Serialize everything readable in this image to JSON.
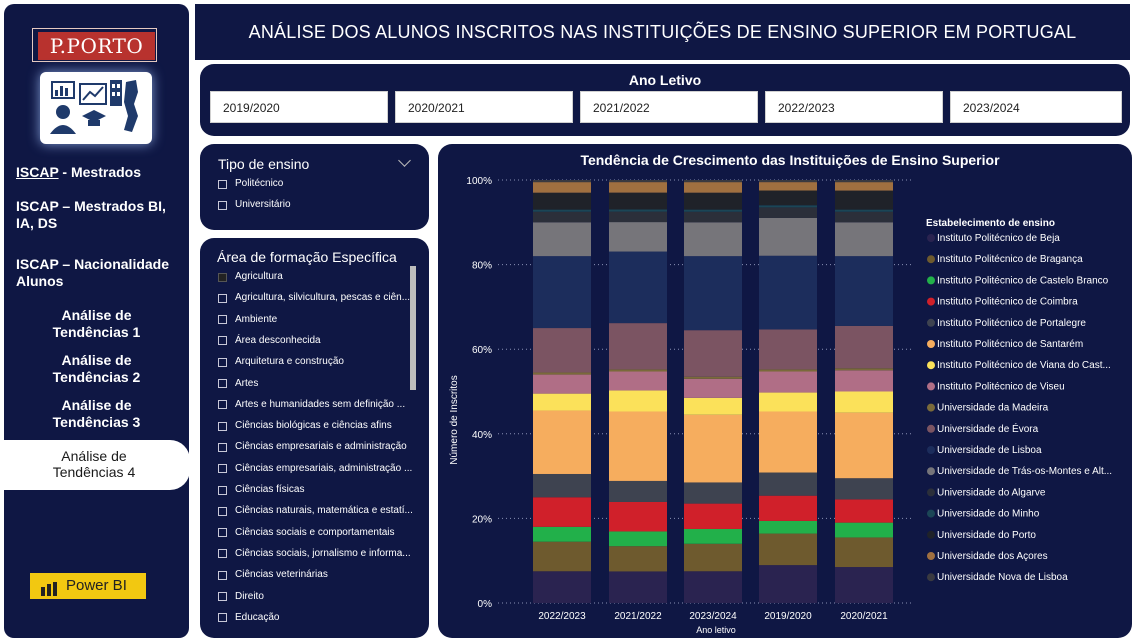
{
  "app": {
    "logo_text": "P.PORTO",
    "powerbi_label": "Power BI",
    "header_title": "ANÁLISE DOS ALUNOS INSCRITOS NAS INSTITUIÇÕES DE ENSINO SUPERIOR EM PORTUGAL"
  },
  "sidebar": {
    "items": [
      {
        "prefix": "ISCAP",
        "label": " - Mestrados"
      },
      {
        "label": "ISCAP – Mestrados BI, IA, DS"
      },
      {
        "label": "ISCAP – Nacionalidade Alunos"
      },
      {
        "label": "Análise de Tendências 1"
      },
      {
        "label": "Análise de Tendências 2"
      },
      {
        "label": "Análise de Tendências 3"
      },
      {
        "label": "Análise de Tendências 4",
        "active": true
      }
    ]
  },
  "year_slicer": {
    "title": "Ano Letivo",
    "options": [
      "2019/2020",
      "2020/2021",
      "2021/2022",
      "2022/2023",
      "2023/2024"
    ]
  },
  "tipo_slicer": {
    "title": "Tipo de ensino",
    "options": [
      "Politécnico",
      "Universitário"
    ]
  },
  "area_slicer": {
    "title": "Área de formação Específica",
    "options": [
      "Agricultura",
      "Agricultura, silvicultura, pescas e ciên...",
      "Ambiente",
      "Área desconhecida",
      "Arquitetura e construção",
      "Artes",
      "Artes e humanidades sem definição ...",
      "Ciências biológicas e ciências afins",
      "Ciências empresariais e administração",
      "Ciências empresariais, administração ...",
      "Ciências físicas",
      "Ciências naturais, matemática e estatí...",
      "Ciências sociais e comportamentais",
      "Ciências sociais, jornalismo e informa...",
      "Ciências veterinárias",
      "Direito",
      "Educação"
    ]
  },
  "chart_data": {
    "type": "bar",
    "stacked": "100%",
    "title": "Tendência de Crescimento das Instituições de Ensino Superior",
    "xlabel": "Ano letivo",
    "ylabel": "Número de Inscritos",
    "y_ticks": [
      "0%",
      "20%",
      "40%",
      "60%",
      "80%",
      "100%"
    ],
    "ylim": [
      0,
      100
    ],
    "legend_title": "Estabelecimento de ensino",
    "legend_position": "right",
    "categories": [
      "2022/2023",
      "2021/2022",
      "2023/2024",
      "2019/2020",
      "2020/2021"
    ],
    "series": [
      {
        "name": "Instituto Politécnico de Beja",
        "color": "#2a2350",
        "values": [
          7.5,
          7.5,
          7.5,
          9.0,
          8.5
        ]
      },
      {
        "name": "Instituto Politécnico de Bragança",
        "color": "#6e5a2e",
        "values": [
          7.0,
          6.0,
          6.5,
          7.5,
          7.0
        ]
      },
      {
        "name": "Instituto Politécnico de Castelo Branco",
        "color": "#22b04a",
        "values": [
          3.5,
          3.5,
          3.5,
          3.0,
          3.5
        ]
      },
      {
        "name": "Instituto Politécnico de Coimbra",
        "color": "#d0202a",
        "values": [
          7.0,
          7.0,
          6.0,
          6.0,
          5.5
        ]
      },
      {
        "name": "Instituto Politécnico de Portalegre",
        "color": "#3e4350",
        "values": [
          5.5,
          5.0,
          5.0,
          5.5,
          5.0
        ]
      },
      {
        "name": "Instituto Politécnico de Santarém",
        "color": "#f6ad5e",
        "values": [
          15.0,
          16.5,
          16.0,
          14.5,
          15.5
        ]
      },
      {
        "name": "Instituto Politécnico de Viana do Castelo",
        "color": "#fbe15a",
        "values": [
          4.0,
          5.0,
          4.0,
          4.5,
          5.0
        ]
      },
      {
        "name": "Instituto Politécnico de Viseu",
        "color": "#b06e86",
        "values": [
          4.5,
          4.5,
          4.5,
          5.0,
          5.0
        ]
      },
      {
        "name": "Universidade da Madeira",
        "color": "#7a6a3a",
        "values": [
          0.5,
          0.5,
          0.5,
          0.5,
          0.5
        ]
      },
      {
        "name": "Universidade de Évora",
        "color": "#7b5462",
        "values": [
          10.5,
          11.0,
          11.0,
          9.5,
          10.0
        ]
      },
      {
        "name": "Universidade de Lisboa",
        "color": "#1c2d5c",
        "values": [
          17.0,
          17.0,
          17.5,
          17.5,
          16.5
        ]
      },
      {
        "name": "Universidade de Trás-os-Montes e Alto Douro",
        "color": "#76757a",
        "values": [
          8.0,
          7.0,
          8.0,
          9.0,
          8.0
        ]
      },
      {
        "name": "Universidade do Algarve",
        "color": "#2b2f3a",
        "values": [
          2.5,
          2.5,
          2.5,
          2.5,
          2.5
        ]
      },
      {
        "name": "Universidade do Minho",
        "color": "#1b4656",
        "values": [
          0.5,
          0.5,
          0.5,
          0.5,
          0.5
        ]
      },
      {
        "name": "Universidade do Porto",
        "color": "#1f2229",
        "values": [
          4.0,
          4.0,
          4.0,
          3.5,
          4.5
        ]
      },
      {
        "name": "Universidade dos Açores",
        "color": "#a07040",
        "values": [
          2.5,
          2.5,
          2.5,
          2.0,
          2.0
        ]
      },
      {
        "name": "Universidade Nova de Lisboa",
        "color": "#3a3a40",
        "values": [
          0.5,
          0.5,
          0.5,
          0.5,
          0.5
        ]
      }
    ],
    "legend_labels": [
      "Instituto Politécnico de Beja",
      "Instituto Politécnico de Bragança",
      "Instituto Politécnico de Castelo Branco",
      "Instituto Politécnico de Coimbra",
      "Instituto Politécnico de Portalegre",
      "Instituto Politécnico de Santarém",
      "Instituto Politécnico de Viana do Cast...",
      "Instituto Politécnico de Viseu",
      "Universidade da Madeira",
      "Universidade de Évora",
      "Universidade de Lisboa",
      "Universidade de Trás-os-Montes e Alt...",
      "Universidade do Algarve",
      "Universidade do Minho",
      "Universidade do Porto",
      "Universidade dos Açores",
      "Universidade Nova de Lisboa"
    ]
  }
}
